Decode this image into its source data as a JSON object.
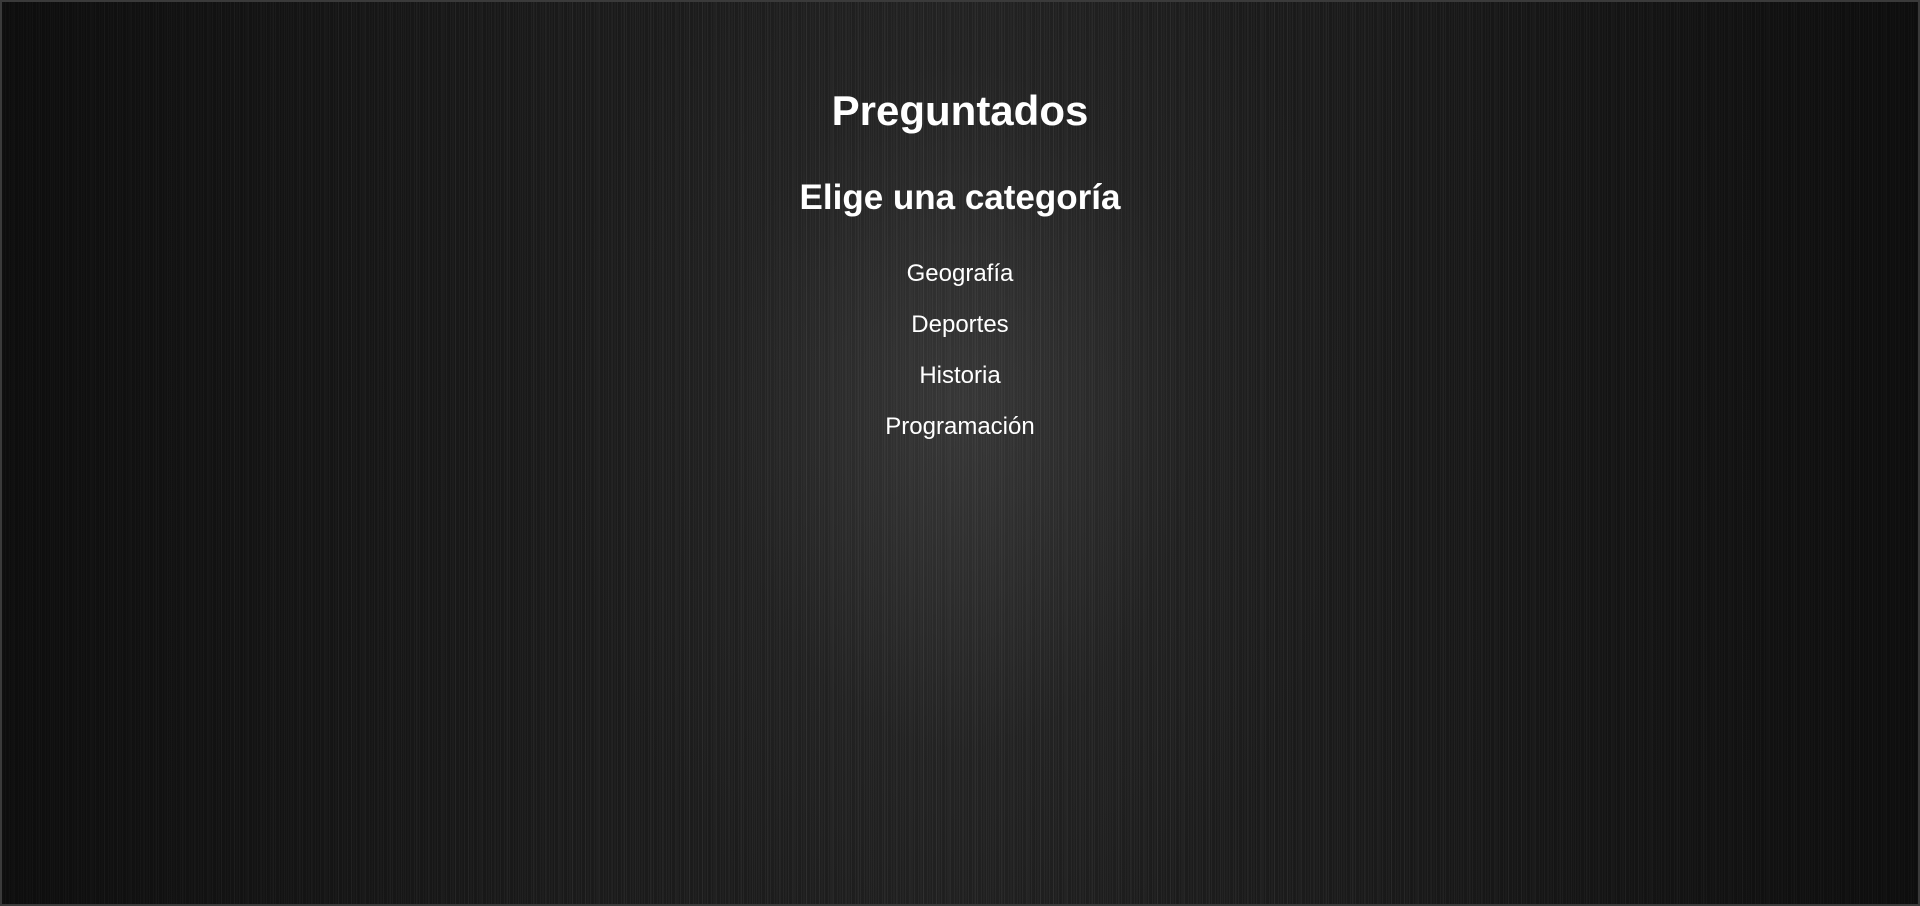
{
  "app": {
    "title": "Preguntados"
  },
  "main": {
    "heading": "Elige una categoría",
    "categories": [
      {
        "label": "Geografía"
      },
      {
        "label": "Deportes"
      },
      {
        "label": "Historia"
      },
      {
        "label": "Programación"
      }
    ]
  },
  "colors": {
    "text": "#ffffff",
    "background": "#1f1f1f"
  }
}
